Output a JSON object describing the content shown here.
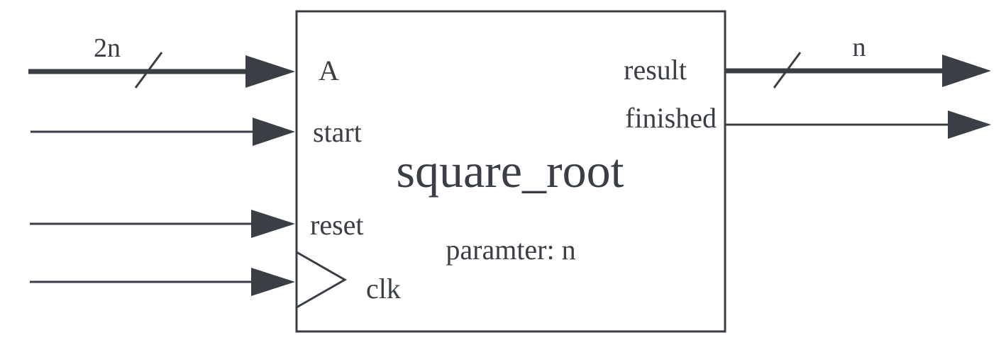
{
  "block": {
    "name": "square_root",
    "parameter_text": "paramter: n"
  },
  "inputs": {
    "a": {
      "label": "A",
      "bus_width": "2n"
    },
    "start": {
      "label": "start"
    },
    "reset": {
      "label": "reset"
    },
    "clk": {
      "label": "clk"
    }
  },
  "outputs": {
    "result": {
      "label": "result",
      "bus_width": "n"
    },
    "finished": {
      "label": "finished"
    }
  },
  "colors": {
    "stroke": "#3a3e45",
    "text": "#3a3e45",
    "background": "#ffffff"
  }
}
